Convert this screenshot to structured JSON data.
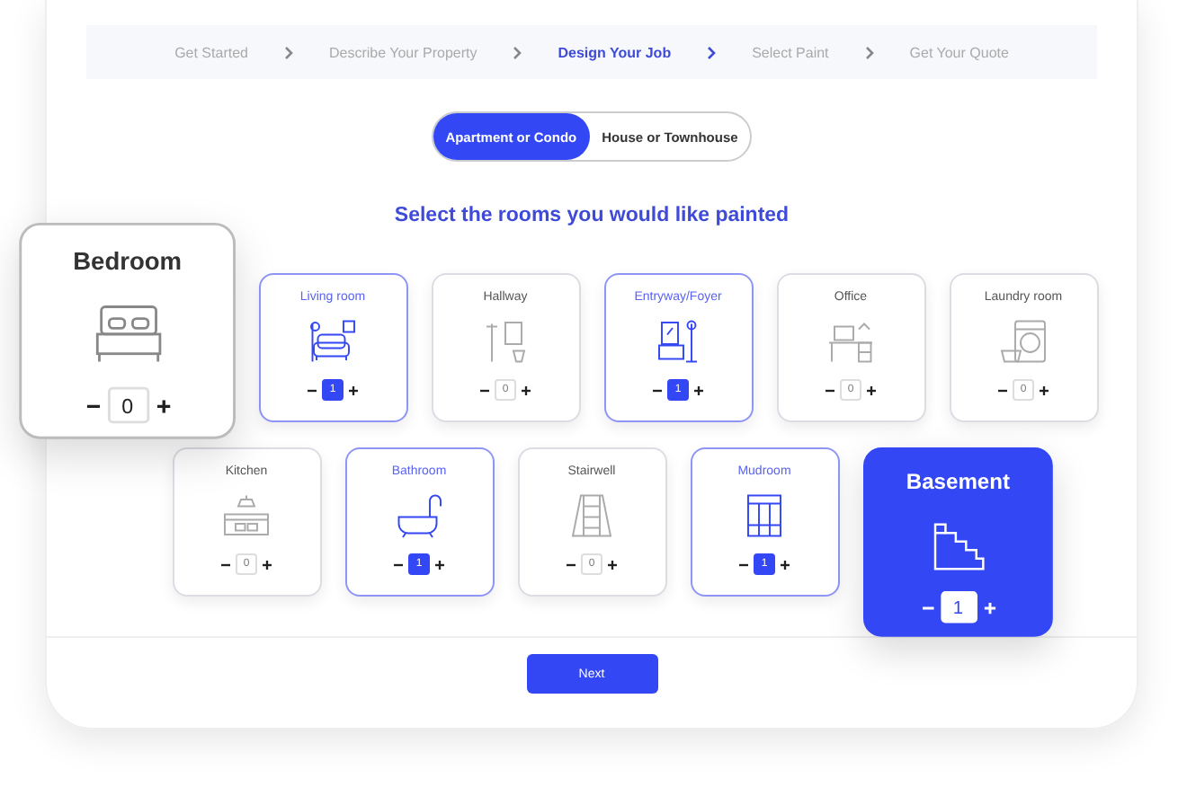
{
  "steps": [
    {
      "label": "Get Started",
      "current": false
    },
    {
      "label": "Describe Your Property",
      "current": false
    },
    {
      "label": "Design Your Job",
      "current": true
    },
    {
      "label": "Select Paint",
      "current": false
    },
    {
      "label": "Get Your Quote",
      "current": false
    }
  ],
  "property_type": [
    {
      "label": "Apartment or Condo",
      "selected": true
    },
    {
      "label": "House or Townhouse",
      "selected": false
    }
  ],
  "heading": "Select the rooms you would like painted",
  "room_rows": [
    [
      {
        "name": "Bedroom",
        "kind": "bed",
        "count": "0",
        "selected": false,
        "highlighted": true
      },
      {
        "name": "Living room",
        "kind": "sofa",
        "count": "1",
        "selected": true,
        "highlighted": false
      },
      {
        "name": "Hallway",
        "kind": "hall",
        "count": "0",
        "selected": false,
        "highlighted": false
      },
      {
        "name": "Entryway/Foyer",
        "kind": "foyer",
        "count": "1",
        "selected": true,
        "highlighted": false
      },
      {
        "name": "Office",
        "kind": "desk",
        "count": "0",
        "selected": false,
        "highlighted": false
      },
      {
        "name": "Laundry room",
        "kind": "washer",
        "count": "0",
        "selected": false,
        "highlighted": false
      }
    ],
    [
      {
        "name": "Kitchen",
        "kind": "kitchen",
        "count": "0",
        "selected": false,
        "highlighted": false
      },
      {
        "name": "Bathroom",
        "kind": "bath",
        "count": "1",
        "selected": true,
        "highlighted": false
      },
      {
        "name": "Stairwell",
        "kind": "stairwell",
        "count": "0",
        "selected": false,
        "highlighted": false
      },
      {
        "name": "Mudroom",
        "kind": "lockers",
        "count": "1",
        "selected": true,
        "highlighted": false
      },
      {
        "name": "Basement",
        "kind": "stairs",
        "count": "1",
        "selected": true,
        "highlighted": true
      }
    ]
  ],
  "next_button": "Next"
}
